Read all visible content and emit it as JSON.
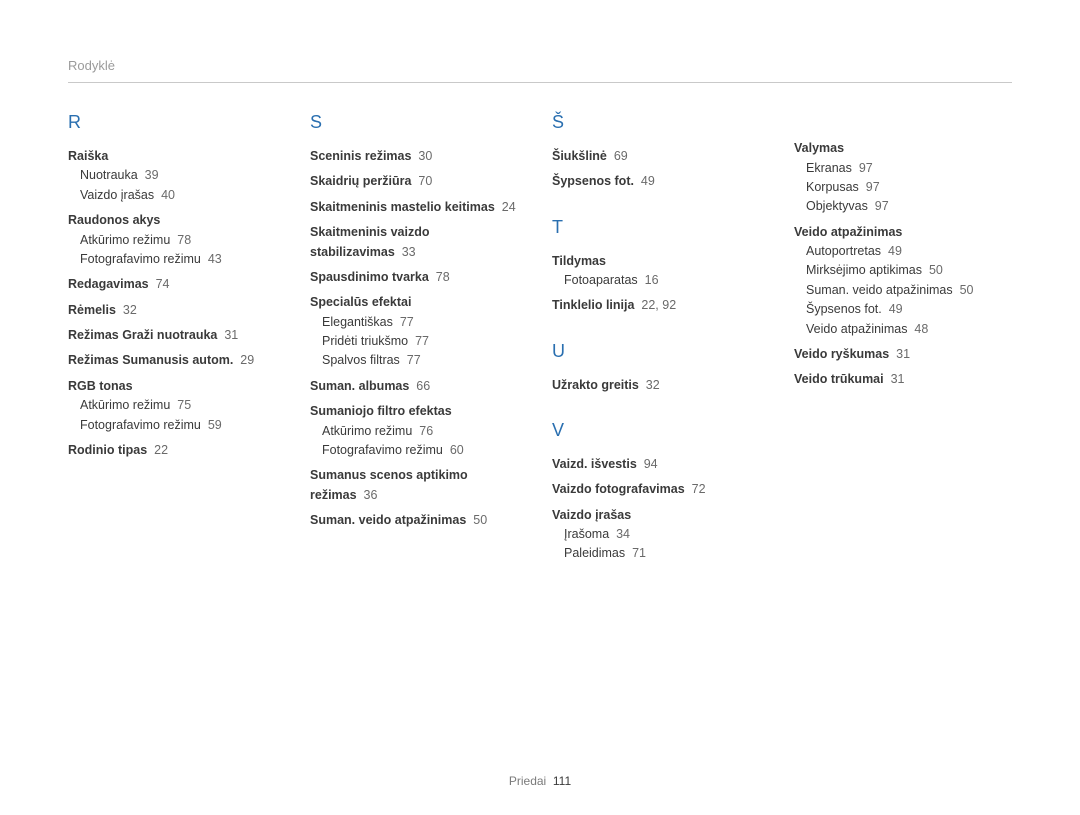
{
  "header": "Rodyklė",
  "footer": {
    "label": "Priedai",
    "page": "111"
  },
  "columns": [
    {
      "sections": [
        {
          "letter": "R",
          "entries": [
            {
              "head": "Raiška",
              "subs": [
                {
                  "label": "Nuotrauka",
                  "pg": "39"
                },
                {
                  "label": "Vaizdo įrašas",
                  "pg": "40"
                }
              ]
            },
            {
              "head": "Raudonos akys",
              "subs": [
                {
                  "label": "Atkūrimo režimu",
                  "pg": "78"
                },
                {
                  "label": "Fotografavimo režimu",
                  "pg": "43"
                }
              ]
            },
            {
              "head": "Redagavimas",
              "pg": "74"
            },
            {
              "head": "Rėmelis",
              "pg": "32"
            },
            {
              "head": "Režimas Graži nuotrauka",
              "pg": "31"
            },
            {
              "head": "Režimas Sumanusis autom.",
              "pg": "29"
            },
            {
              "head": "RGB tonas",
              "subs": [
                {
                  "label": "Atkūrimo režimu",
                  "pg": "75"
                },
                {
                  "label": "Fotografavimo režimu",
                  "pg": "59"
                }
              ]
            },
            {
              "head": "Rodinio tipas",
              "pg": "22"
            }
          ]
        }
      ]
    },
    {
      "sections": [
        {
          "letter": "S",
          "entries": [
            {
              "head": "Sceninis režimas",
              "pg": "30"
            },
            {
              "head": "Skaidrių peržiūra",
              "pg": "70"
            },
            {
              "head": "Skaitmeninis mastelio keitimas",
              "pg": "24"
            },
            {
              "head": "Skaitmeninis vaizdo stabilizavimas",
              "pg": "33"
            },
            {
              "head": "Spausdinimo tvarka",
              "pg": "78"
            },
            {
              "head": "Specialūs efektai",
              "subs": [
                {
                  "label": "Elegantiškas",
                  "pg": "77"
                },
                {
                  "label": "Pridėti triukšmo",
                  "pg": "77"
                },
                {
                  "label": "Spalvos filtras",
                  "pg": "77"
                }
              ]
            },
            {
              "head": "Suman. albumas",
              "pg": "66"
            },
            {
              "head": "Sumaniojo filtro efektas",
              "subs": [
                {
                  "label": "Atkūrimo režimu",
                  "pg": "76"
                },
                {
                  "label": "Fotografavimo režimu",
                  "pg": "60"
                }
              ]
            },
            {
              "head": "Sumanus scenos aptikimo režimas",
              "pg": "36"
            },
            {
              "head": "Suman. veido atpažinimas",
              "pg": "50"
            }
          ]
        }
      ]
    },
    {
      "sections": [
        {
          "letter": "Š",
          "entries": [
            {
              "head": "Šiukšlinė",
              "pg": "69"
            },
            {
              "head": "Šypsenos fot.",
              "pg": "49"
            }
          ]
        },
        {
          "letter": "T",
          "entries": [
            {
              "head": "Tildymas",
              "subs": [
                {
                  "label": "Fotoaparatas",
                  "pg": "16"
                }
              ]
            },
            {
              "head": "Tinklelio linija",
              "pg": "22, 92"
            }
          ]
        },
        {
          "letter": "U",
          "entries": [
            {
              "head": "Užrakto greitis",
              "pg": "32"
            }
          ]
        },
        {
          "letter": "V",
          "entries": [
            {
              "head": "Vaizd. išvestis",
              "pg": "94"
            },
            {
              "head": "Vaizdo fotografavimas",
              "pg": "72"
            },
            {
              "head": "Vaizdo įrašas",
              "subs": [
                {
                  "label": "Įrašoma",
                  "pg": "34"
                },
                {
                  "label": "Paleidimas",
                  "pg": "71"
                }
              ]
            }
          ]
        }
      ]
    },
    {
      "sections": [
        {
          "letter": "",
          "entries": [
            {
              "head": "Valymas",
              "subs": [
                {
                  "label": "Ekranas",
                  "pg": "97"
                },
                {
                  "label": "Korpusas",
                  "pg": "97"
                },
                {
                  "label": "Objektyvas",
                  "pg": "97"
                }
              ]
            },
            {
              "head": "Veido atpažinimas",
              "subs": [
                {
                  "label": "Autoportretas",
                  "pg": "49"
                },
                {
                  "label": "Mirksėjimo aptikimas",
                  "pg": "50"
                },
                {
                  "label": "Suman. veido atpažinimas",
                  "pg": "50"
                },
                {
                  "label": "Šypsenos fot.",
                  "pg": "49"
                },
                {
                  "label": "Veido atpažinimas",
                  "pg": "48"
                }
              ]
            },
            {
              "head": "Veido ryškumas",
              "pg": "31"
            },
            {
              "head": "Veido trūkumai",
              "pg": "31"
            }
          ]
        }
      ]
    }
  ]
}
